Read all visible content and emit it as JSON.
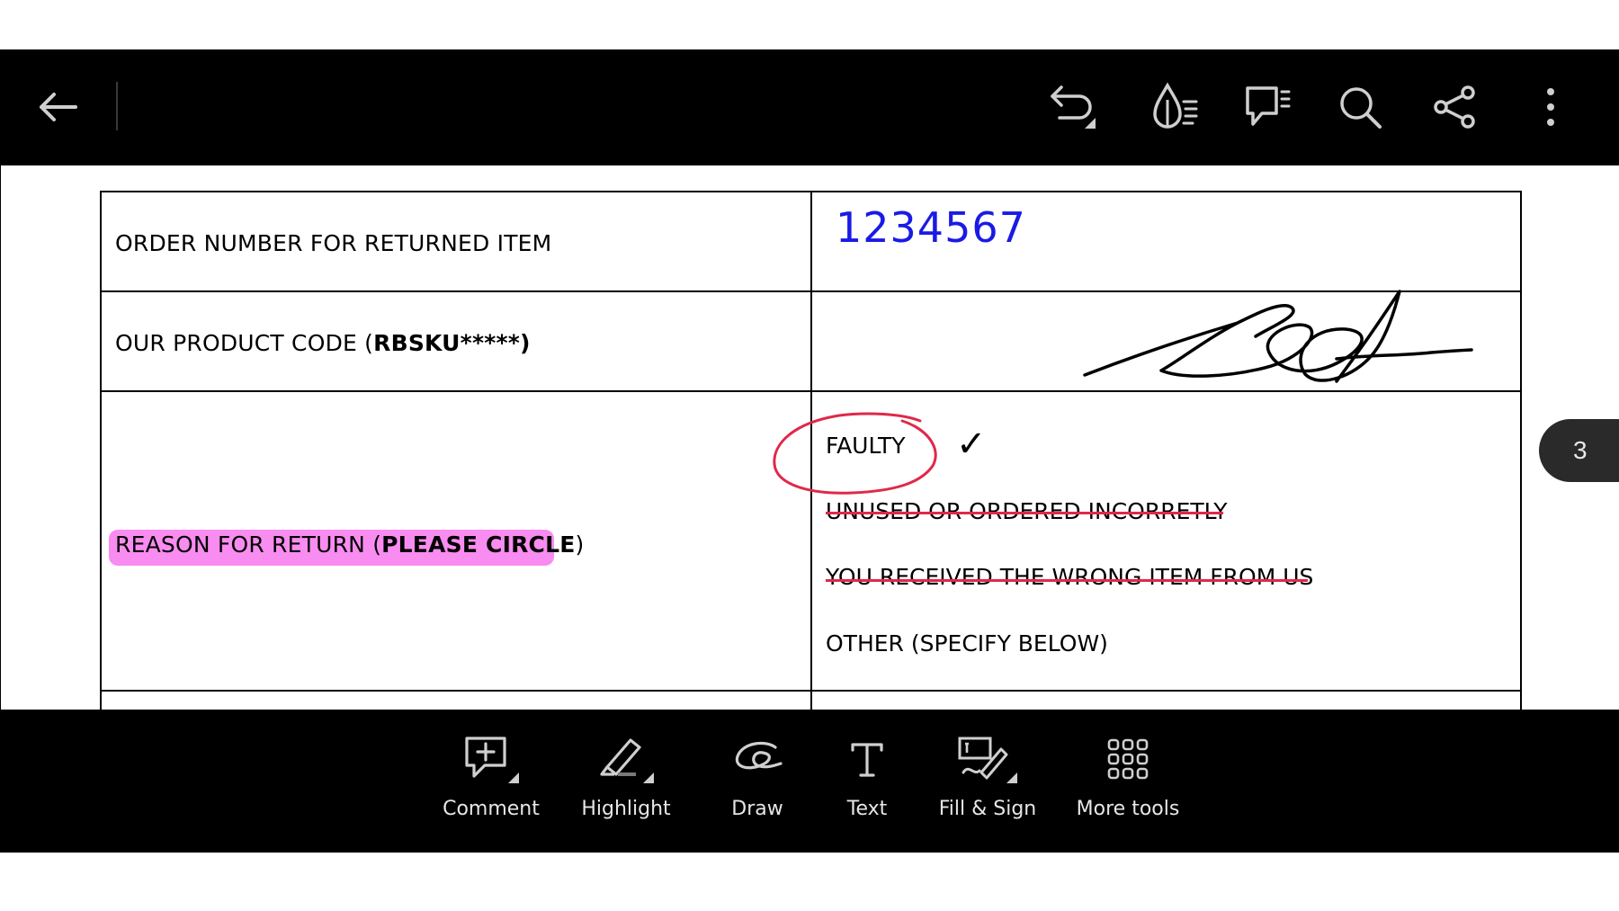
{
  "colors": {
    "bar_bg": "#000000",
    "icon": "#cfcfcf",
    "handwriting_blue": "#1a1ae6",
    "ink_red": "#e0284a",
    "highlight_pink": "#f98cf0"
  },
  "toolbar": {
    "back_icon": "back-arrow-icon",
    "undo_icon": "undo-icon",
    "accessibility_icon": "liquid-mode-icon",
    "comments_icon": "comments-list-icon",
    "search_icon": "search-icon",
    "share_icon": "share-icon",
    "more_icon": "more-vertical-icon"
  },
  "form": {
    "rows": [
      {
        "label": "ORDER NUMBER FOR RETURNED ITEM"
      },
      {
        "label_prefix": "OUR PRODUCT CODE (",
        "label_bold": "RBSKU*****)",
        "label_suffix": ""
      },
      {
        "label_prefix": "REASON FOR RETURN (",
        "label_bold": "PLEASE CIRCLE",
        "label_suffix": ")"
      }
    ],
    "order_number_value": "1234567",
    "reasons": [
      {
        "text": "FAULTY",
        "circled": true,
        "checked": true
      },
      {
        "text": "UNUSED OR ORDERED INCORRETLY",
        "struck": true
      },
      {
        "text": "YOU RECEIVED THE WRONG ITEM FROM US",
        "struck": true
      },
      {
        "text": "OTHER (SPECIFY BELOW)",
        "struck": false
      }
    ],
    "check_mark": "✓"
  },
  "page_indicator": "3",
  "bottom_tools": [
    {
      "label": "Comment",
      "icon": "comment-add-icon"
    },
    {
      "label": "Highlight",
      "icon": "highlighter-icon"
    },
    {
      "label": "Draw",
      "icon": "draw-icon"
    },
    {
      "label": "Text",
      "icon": "text-icon"
    },
    {
      "label": "Fill & Sign",
      "icon": "fill-sign-icon"
    },
    {
      "label": "More tools",
      "icon": "grid-icon"
    }
  ]
}
